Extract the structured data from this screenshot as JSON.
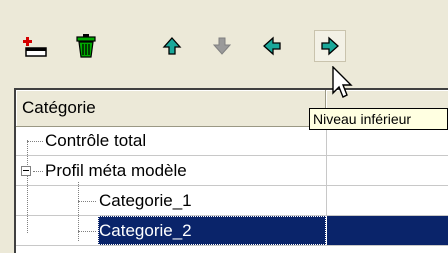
{
  "toolbar": {
    "buttons": [
      {
        "name": "add-category-button",
        "icon": "add-category-icon"
      },
      {
        "name": "delete-button",
        "icon": "trash-icon"
      },
      {
        "name": "move-up-button",
        "icon": "arrow-up-icon"
      },
      {
        "name": "move-down-button",
        "icon": "arrow-down-icon",
        "disabled": true
      },
      {
        "name": "move-left-button",
        "icon": "arrow-left-icon"
      },
      {
        "name": "move-right-button",
        "icon": "arrow-right-icon",
        "hovered": true
      }
    ]
  },
  "tree": {
    "header": {
      "column1": "Catégorie"
    },
    "rows": [
      {
        "label": "Contrôle total"
      },
      {
        "label": "Profil méta modèle",
        "expanded": true
      },
      {
        "label": "Categorie_1"
      },
      {
        "label": "Categorie_2",
        "selected": true
      }
    ]
  },
  "tooltip": {
    "text": "Niveau inférieur"
  },
  "colors": {
    "selection": "#0a246a",
    "arrow": "#1aa89a",
    "tooltip_bg": "#ffffe1",
    "window_bg": "#ece9d8"
  }
}
